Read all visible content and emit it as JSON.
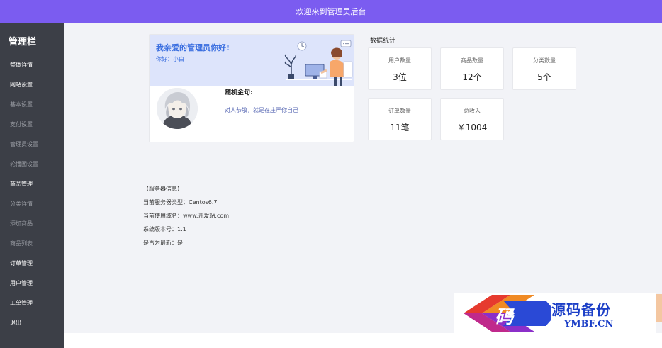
{
  "header": {
    "title": "欢迎来到管理员后台"
  },
  "sidebar": {
    "title": "管理栏",
    "items": [
      {
        "label": "整体详情",
        "active": true
      },
      {
        "label": "网站设置",
        "active": true
      },
      {
        "label": "基本设置",
        "active": false
      },
      {
        "label": "支付设置",
        "active": false
      },
      {
        "label": "管理员设置",
        "active": false
      },
      {
        "label": "轮播图设置",
        "active": false
      },
      {
        "label": "商品管理",
        "active": true
      },
      {
        "label": "分类详情",
        "active": false
      },
      {
        "label": "添加商品",
        "active": false
      },
      {
        "label": "商品列表",
        "active": false
      },
      {
        "label": "订单管理",
        "active": true
      },
      {
        "label": "用户管理",
        "active": true
      },
      {
        "label": "工单管理",
        "active": true
      },
      {
        "label": "退出",
        "active": true
      }
    ]
  },
  "profile": {
    "greeting": "我亲爱的管理员你好!",
    "hello": "你好：小白",
    "quote_label": "随机金句:",
    "quote_text": "对人恭敬，就是在庄严你自己"
  },
  "stats": {
    "title": "数据统计",
    "cards": [
      {
        "label": "用户数量",
        "value": "3位"
      },
      {
        "label": "商品数量",
        "value": "12个"
      },
      {
        "label": "分类数量",
        "value": "5个"
      },
      {
        "label": "订单数量",
        "value": "11笔"
      },
      {
        "label": "总收入",
        "value": "￥1004"
      }
    ]
  },
  "server": {
    "heading": "【服务器信息】",
    "lines": [
      "当前服务器类型：Centos6.7",
      "当前使用域名：www.开发站.com",
      "系统版本号：1.1",
      "是否为最新：是"
    ]
  },
  "watermark": {
    "char": "码",
    "text_cn": "源码备份",
    "text_en": "YMBF.CN"
  },
  "colors": {
    "header_bg": "#7b5cf0",
    "sidebar_bg": "#3c3f47",
    "accent": "#3b6fe0"
  }
}
